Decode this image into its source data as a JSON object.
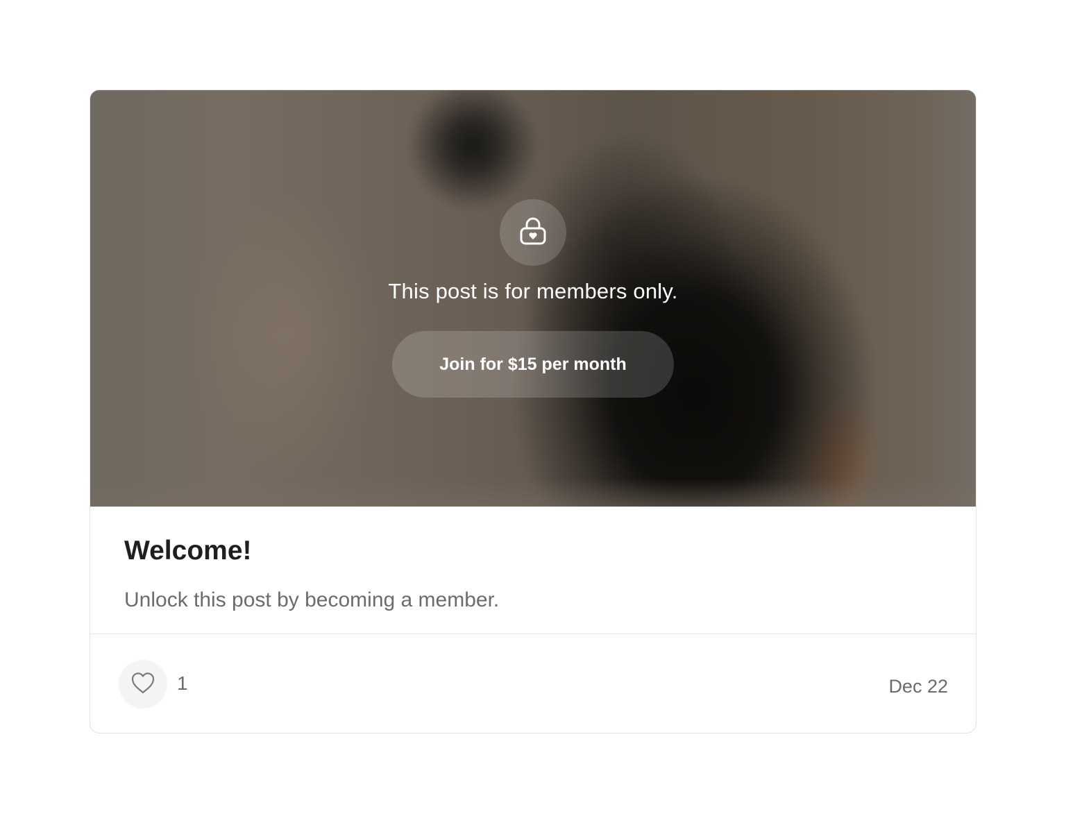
{
  "post": {
    "locked_message": "This post is for members only.",
    "join_button_label": "Join for $15 per month",
    "title": "Welcome!",
    "subtitle": "Unlock this post by becoming a member.",
    "like_count": "1",
    "date": "Dec 22"
  },
  "icons": {
    "lock": "lock-heart-icon",
    "like": "heart-icon"
  }
}
